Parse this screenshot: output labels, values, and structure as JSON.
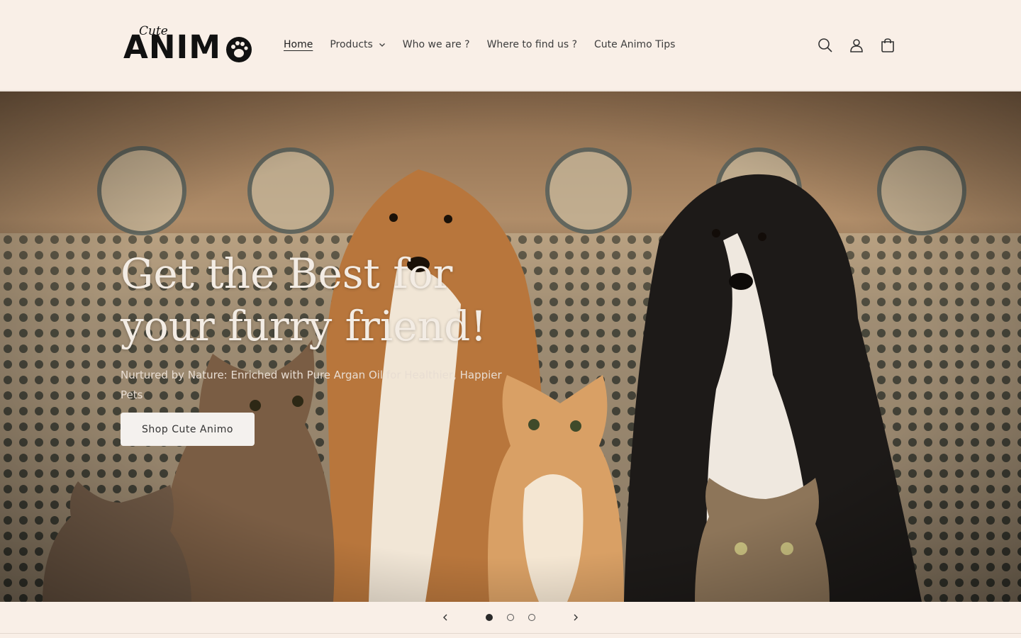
{
  "brand": {
    "script": "Cute",
    "word": "ANIM"
  },
  "nav": {
    "items": [
      {
        "label": "Home",
        "active": true
      },
      {
        "label": "Products",
        "has_dropdown": true
      },
      {
        "label": "Who we are ?"
      },
      {
        "label": "Where to find us ?"
      },
      {
        "label": "Cute Animo Tips"
      }
    ]
  },
  "header_icons": [
    "search-icon",
    "account-icon",
    "cart-icon"
  ],
  "hero": {
    "title_line1": "Get the Best for",
    "title_line2": "your furry friend!",
    "subtitle": "Nurtured by Nature: Enriched with Pure Argan Oil for Healthier, Happier Pets",
    "button_label": "Shop Cute Animo"
  },
  "slider": {
    "slide_count": 3,
    "current_slide": 1,
    "prev_icon": "chevron-left-icon",
    "next_icon": "chevron-right-icon"
  },
  "colors": {
    "background": "#f9efe7",
    "text": "#2a2a2a",
    "hero_title": "#f3ece4",
    "button_bg": "#f4f1ee"
  }
}
